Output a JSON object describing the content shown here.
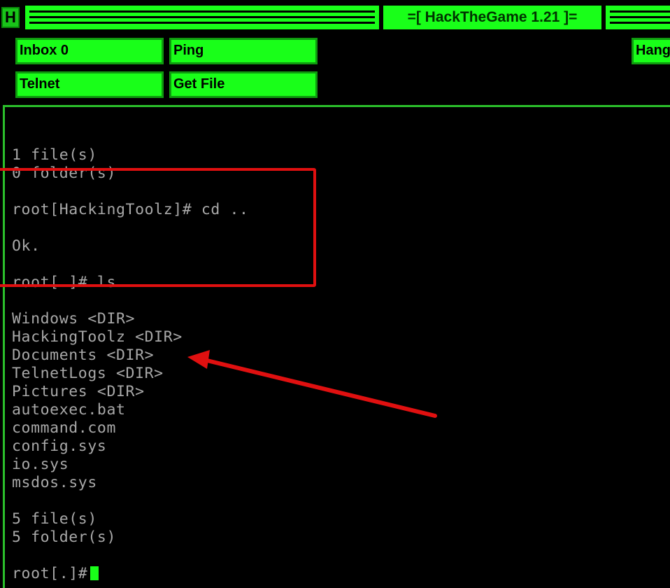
{
  "titlebar": {
    "app_icon_letter": "H",
    "title": "=[ HackTheGame 1.21 ]="
  },
  "toolbar": {
    "inbox_label": "Inbox 0",
    "ping_label": "Ping",
    "telnet_label": "Telnet",
    "getfile_label": "Get File",
    "hang_label": "Hang"
  },
  "terminal": {
    "lines": [
      "",
      "1 file(s)",
      "0 folder(s)",
      "",
      "root[HackingToolz]# cd ..",
      "",
      "Ok.",
      "",
      "root[.]# ls",
      "",
      "Windows <DIR>",
      "HackingToolz <DIR>",
      "Documents <DIR>",
      "TelnetLogs <DIR>",
      "Pictures <DIR>",
      "autoexec.bat",
      "command.com",
      "config.sys",
      "io.sys",
      "msdos.sys",
      "",
      "5 file(s)",
      "5 folder(s)",
      "",
      "root[.]#"
    ]
  },
  "colors": {
    "accent_green": "#19ff19",
    "terminal_text": "#a8a8a8",
    "annotation_red": "#e01010"
  }
}
